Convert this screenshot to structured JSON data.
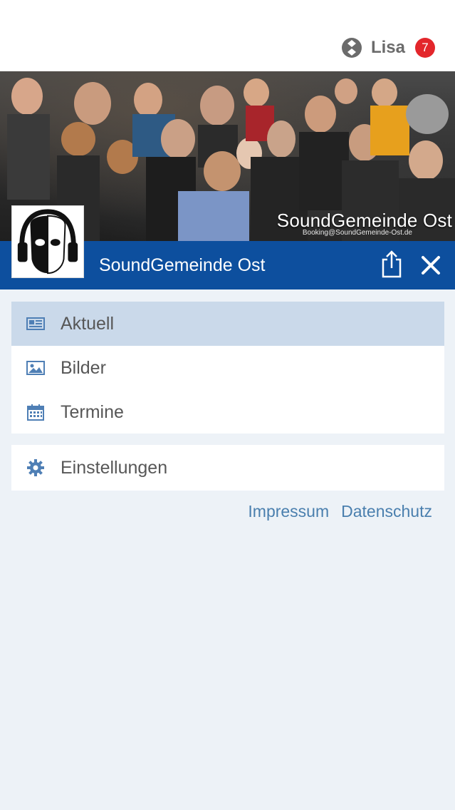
{
  "user": {
    "name": "Lisa",
    "notification_count": "7",
    "icon": "profile-badge-icon"
  },
  "banner": {
    "title": "SoundGemeinde Ost",
    "booking": "Booking@SoundGemeinde-Ost.de"
  },
  "header": {
    "title": "SoundGemeinde Ost",
    "share_icon": "share-icon",
    "close_icon": "close-icon"
  },
  "menu": {
    "items": [
      {
        "label": "Aktuell",
        "icon": "newspaper-icon",
        "active": true
      },
      {
        "label": "Bilder",
        "icon": "image-icon",
        "active": false
      },
      {
        "label": "Termine",
        "icon": "calendar-icon",
        "active": false
      }
    ],
    "settings": {
      "label": "Einstellungen",
      "icon": "gear-icon"
    }
  },
  "footer": {
    "impressum": "Impressum",
    "datenschutz": "Datenschutz"
  },
  "colors": {
    "header": "#0d4f9e",
    "active_item": "#cad9ea",
    "badge": "#e3262b",
    "link": "#4a7fae",
    "background": "#edf2f7"
  }
}
